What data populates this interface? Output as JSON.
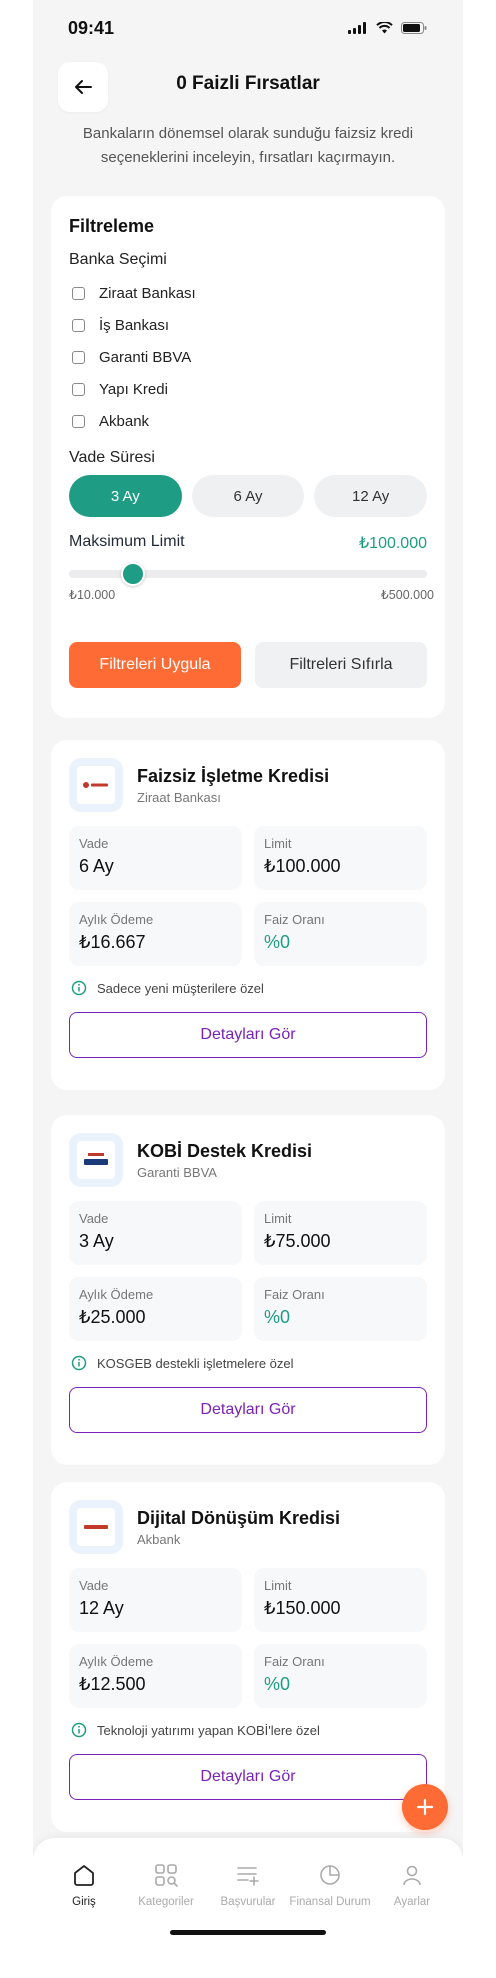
{
  "status": {
    "time": "09:41"
  },
  "header": {
    "title": "0 Faizli Fırsatlar"
  },
  "subtitle": "Bankaların dönemsel olarak sunduğu faizsiz kredi seçeneklerini inceleyin, fırsatları kaçırmayın.",
  "filter": {
    "title": "Filtreleme",
    "bank_label": "Banka Seçimi",
    "banks": [
      "Ziraat Bankası",
      "İş Bankası",
      "Garanti BBVA",
      "Yapı Kredi",
      "Akbank"
    ],
    "term_label": "Vade Süresi",
    "terms": [
      "3 Ay",
      "6 Ay",
      "12 Ay"
    ],
    "selected_term": "3 Ay",
    "limit_label": "Maksimum Limit",
    "limit_value": "₺100.000",
    "limit_min": "₺10.000",
    "limit_max": "₺500.000",
    "limit_fraction": 0.18,
    "apply_label": "Filtreleri Uygula",
    "reset_label": "Filtreleri Sıfırla"
  },
  "labels": {
    "term": "Vade",
    "limit": "Limit",
    "monthly": "Aylık Ödeme",
    "rate": "Faiz Oranı",
    "details": "Detayları Gör"
  },
  "loans": [
    {
      "title": "Faizsiz İşletme Kredisi",
      "bank": "Ziraat Bankası",
      "term": "6 Ay",
      "limit": "₺100.000",
      "monthly": "₺16.667",
      "rate": "%0",
      "note": "Sadece yeni müşterilere özel"
    },
    {
      "title": "KOBİ Destek Kredisi",
      "bank": "Garanti BBVA",
      "term": "3 Ay",
      "limit": "₺75.000",
      "monthly": "₺25.000",
      "rate": "%0",
      "note": "KOSGEB destekli işletmelere özel"
    },
    {
      "title": "Dijital Dönüşüm Kredisi",
      "bank": "Akbank",
      "term": "12 Ay",
      "limit": "₺150.000",
      "monthly": "₺12.500",
      "rate": "%0",
      "note": "Teknoloji yatırımı yapan KOBİ'lere özel"
    }
  ],
  "tabs": [
    {
      "label": "Giriş",
      "icon": "home-icon",
      "active": true
    },
    {
      "label": "Kategoriler",
      "icon": "categories-icon",
      "active": false
    },
    {
      "label": "Başvurular",
      "icon": "list-add-icon",
      "active": false
    },
    {
      "label": "Finansal Durum",
      "icon": "pie-chart-icon",
      "active": false
    },
    {
      "label": "Ayarlar",
      "icon": "user-icon",
      "active": false
    }
  ],
  "colors": {
    "teal": "#1f9d84",
    "orange": "#ff6b35",
    "purple": "#7b22b6"
  }
}
